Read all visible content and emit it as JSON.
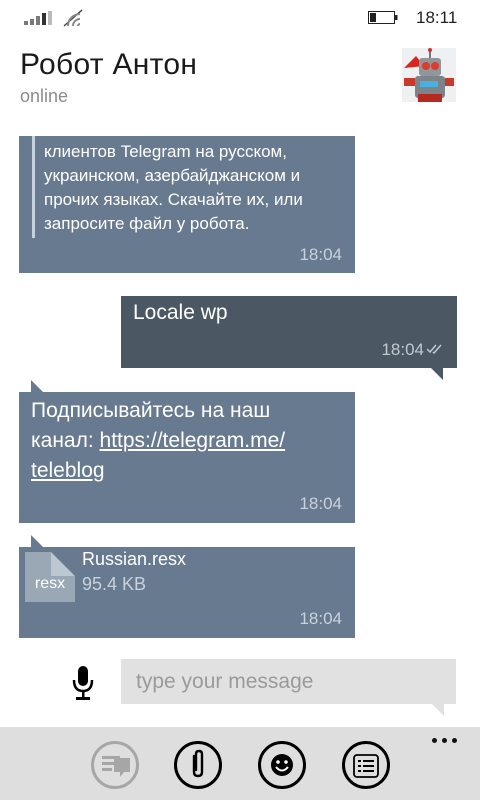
{
  "status_bar": {
    "time": "18:11",
    "icons": [
      "signal-icon",
      "wifi-icon",
      "battery-icon"
    ]
  },
  "header": {
    "contact_name": "Робот Антон",
    "status": "online",
    "avatar_icon": "robot-avatar"
  },
  "messages": [
    {
      "direction": "incoming",
      "text": "клиентов Telegram на русском, украинском, азербайджанском и прочих языках. Скачайте их, или запросите файл у робота.",
      "time": "18:04"
    },
    {
      "direction": "outgoing",
      "text": "Locale wp",
      "time": "18:04",
      "status_icon": "double-check-icon"
    },
    {
      "direction": "incoming",
      "text_prefix": "Подписывайтесь на наш канал: ",
      "link": "https://telegram.me/teleblog",
      "time": "18:04"
    },
    {
      "direction": "incoming",
      "file": {
        "extension": "resx",
        "name": "Russian.resx",
        "size": "95.4 KB"
      },
      "time": "18:04"
    }
  ],
  "input": {
    "placeholder": "type your message"
  },
  "app_bar": {
    "buttons": [
      "send-icon",
      "attach-icon",
      "emoji-icon",
      "commands-icon"
    ],
    "more_icon": "more-dots-icon"
  },
  "colors": {
    "incoming_bubble": "#677a8f",
    "outgoing_bubble": "#4c5764",
    "input_background": "#e1e1e1",
    "app_bar_background": "#dedede"
  }
}
